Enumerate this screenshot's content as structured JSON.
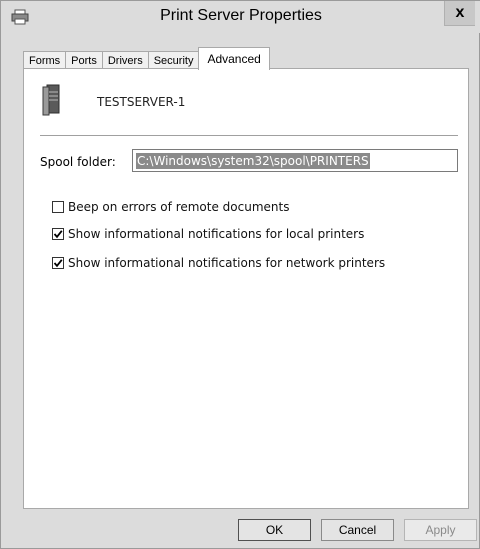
{
  "window": {
    "title": "Print Server Properties",
    "close_label": "x"
  },
  "tabs": [
    {
      "label": "Forms"
    },
    {
      "label": "Ports"
    },
    {
      "label": "Drivers"
    },
    {
      "label": "Security"
    },
    {
      "label": "Advanced",
      "active": true
    }
  ],
  "server": {
    "name": "TESTSERVER-1"
  },
  "spool": {
    "label": "Spool folder:",
    "value": "C:\\Windows\\system32\\spool\\PRINTERS"
  },
  "options": [
    {
      "label": "Beep on errors of remote documents",
      "checked": false
    },
    {
      "label": "Show informational notifications for local printers",
      "checked": true
    },
    {
      "label": "Show informational notifications for network printers",
      "checked": true
    }
  ],
  "buttons": {
    "ok": "OK",
    "cancel": "Cancel",
    "apply": "Apply"
  },
  "colors": {
    "window_bg": "#dcdcdc",
    "panel_bg": "#ffffff",
    "selection": "#8a8a8a"
  }
}
